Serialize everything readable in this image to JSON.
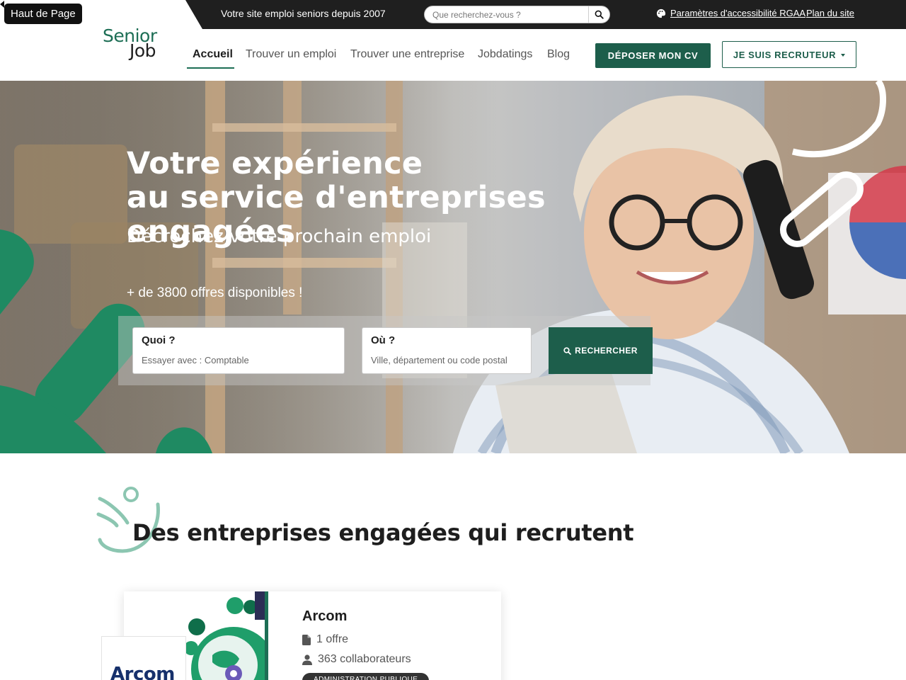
{
  "back_to_top": "Haut de Page",
  "topbar": {
    "tagline": "Votre site emploi seniors depuis 2007",
    "search_placeholder": "Que recherchez-vous ?",
    "accessibility_link": "Paramètres d'accessibilité RGAA",
    "sitemap_link": "Plan du site"
  },
  "logo": {
    "line1": "Senior",
    "line2": "Job"
  },
  "nav": {
    "items": [
      {
        "label": "Accueil",
        "active": true
      },
      {
        "label": "Trouver un emploi"
      },
      {
        "label": "Trouver une entreprise"
      },
      {
        "label": "Jobdatings"
      },
      {
        "label": "Blog"
      }
    ],
    "deposit_cv": "DÉPOSER MON CV",
    "recruiter": "JE SUIS RECRUTEUR"
  },
  "hero": {
    "title_line1": "Votre expérience",
    "title_line2": "au service d'entreprises engagées",
    "subtitle": "Décrochez votre prochain emploi",
    "offers_count": "+ de 3800 offres disponibles !",
    "what_label": "Quoi ?",
    "what_placeholder": "Essayer avec : Comptable",
    "where_label": "Où ?",
    "where_placeholder": "Ville, département ou code postal",
    "search_button": "RECHERCHER"
  },
  "companies": {
    "title": "Des entreprises engagées qui recrutent",
    "cards": [
      {
        "name": "Arcom",
        "logo_text": "Arcom",
        "offers": "1 offre",
        "employees": "363 collaborateurs",
        "sector": "ADMINISTRATION PUBLIQUE"
      }
    ]
  },
  "colors": {
    "brand_green": "#1d5e4b",
    "topbar_bg": "#1f1f1f",
    "text_dark": "#1e1e1e"
  }
}
